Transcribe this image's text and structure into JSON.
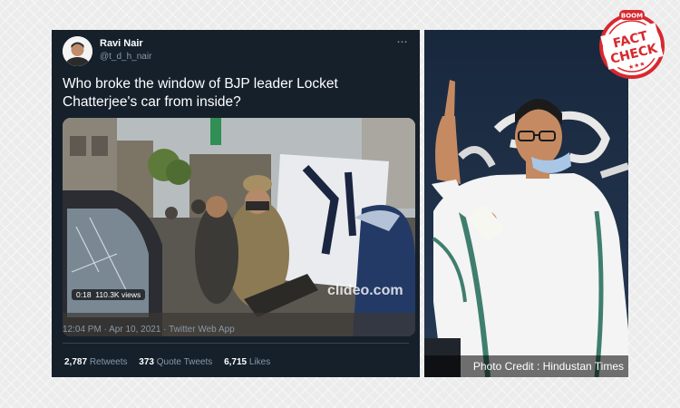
{
  "tweet": {
    "display_name": "Ravi Nair",
    "handle": "@t_d_h_nair",
    "more_glyph": "···",
    "text": "Who broke the window of BJP leader Locket Chatterjee's car from inside?",
    "media": {
      "video_time": "0:18",
      "views": "110.3K views",
      "watermark": "clideo.com"
    },
    "meta": "12:04 PM · Apr 10, 2021 · Twitter Web App",
    "stats": {
      "retweets_count": "2,787",
      "retweets_label": "Retweets",
      "quotes_count": "373",
      "quotes_label": "Quote Tweets",
      "likes_count": "6,715",
      "likes_label": "Likes"
    }
  },
  "photo": {
    "credit": "Photo Credit : Hindustan Times"
  },
  "stamp": {
    "top": "BOOM",
    "line1": "FACT",
    "line2": "CHECK",
    "stars": "★★★",
    "color": "#d8282f"
  },
  "colors": {
    "tweet_bg": "#15202b",
    "muted": "#8899a6",
    "divider": "#38444d"
  }
}
